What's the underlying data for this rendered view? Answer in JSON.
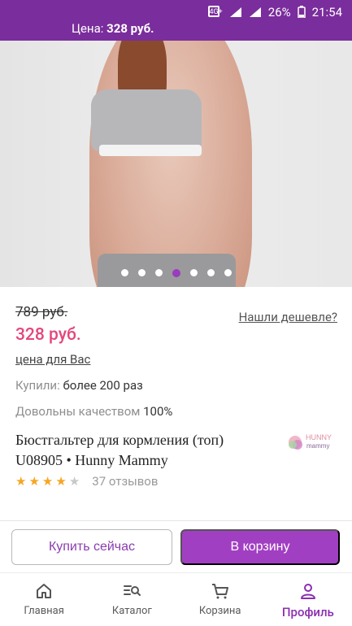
{
  "status_bar": {
    "network": "4G+",
    "battery": "26%",
    "time": "21:54"
  },
  "header": {
    "price_label": "Цена:",
    "price_value": "328 руб."
  },
  "gallery": {
    "dots_count": 7,
    "active_index": 3
  },
  "product": {
    "old_price": "789 руб.",
    "new_price": "328 руб.",
    "your_price_link": "цена для Вас",
    "find_cheaper_link": "Нашли дешевле?",
    "bought_label": "Купили:",
    "bought_value": "более 200 раз",
    "satisfied_label": "Довольны качеством",
    "satisfied_value": "100%",
    "title": "Бюстгальтер для кормления (топ) U08905 • Hunny Mammy",
    "brand_logo_text": "HUNNY mammy",
    "rating": 4,
    "rating_max": 5,
    "reviews": "37 отзывов"
  },
  "actions": {
    "buy_now": "Купить сейчас",
    "to_cart": "В корзину"
  },
  "nav": {
    "items": [
      {
        "label": "Главная",
        "icon": "home-icon"
      },
      {
        "label": "Каталог",
        "icon": "catalog-search-icon"
      },
      {
        "label": "Корзина",
        "icon": "cart-icon"
      },
      {
        "label": "Профиль",
        "icon": "profile-icon"
      }
    ],
    "active_index": 3
  },
  "colors": {
    "brand_purple": "#7a2d9c",
    "cart_button": "#a13fc2",
    "price_pink": "#e4477a",
    "star": "#f5a623"
  }
}
